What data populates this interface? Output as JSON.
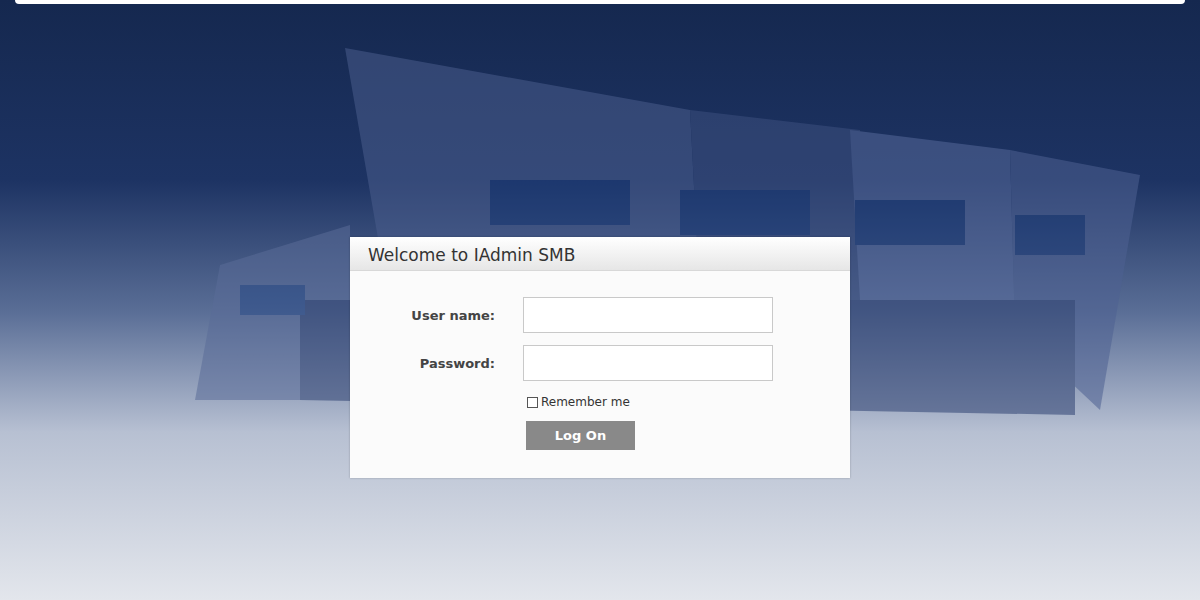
{
  "header": {
    "title": "Welcome to IAdmin SMB"
  },
  "form": {
    "fields": [
      {
        "label": "User name:",
        "value": ""
      },
      {
        "label": "Password:",
        "value": ""
      }
    ],
    "remember": {
      "label": "Remember me",
      "checked": false
    },
    "submit": "Log On"
  }
}
